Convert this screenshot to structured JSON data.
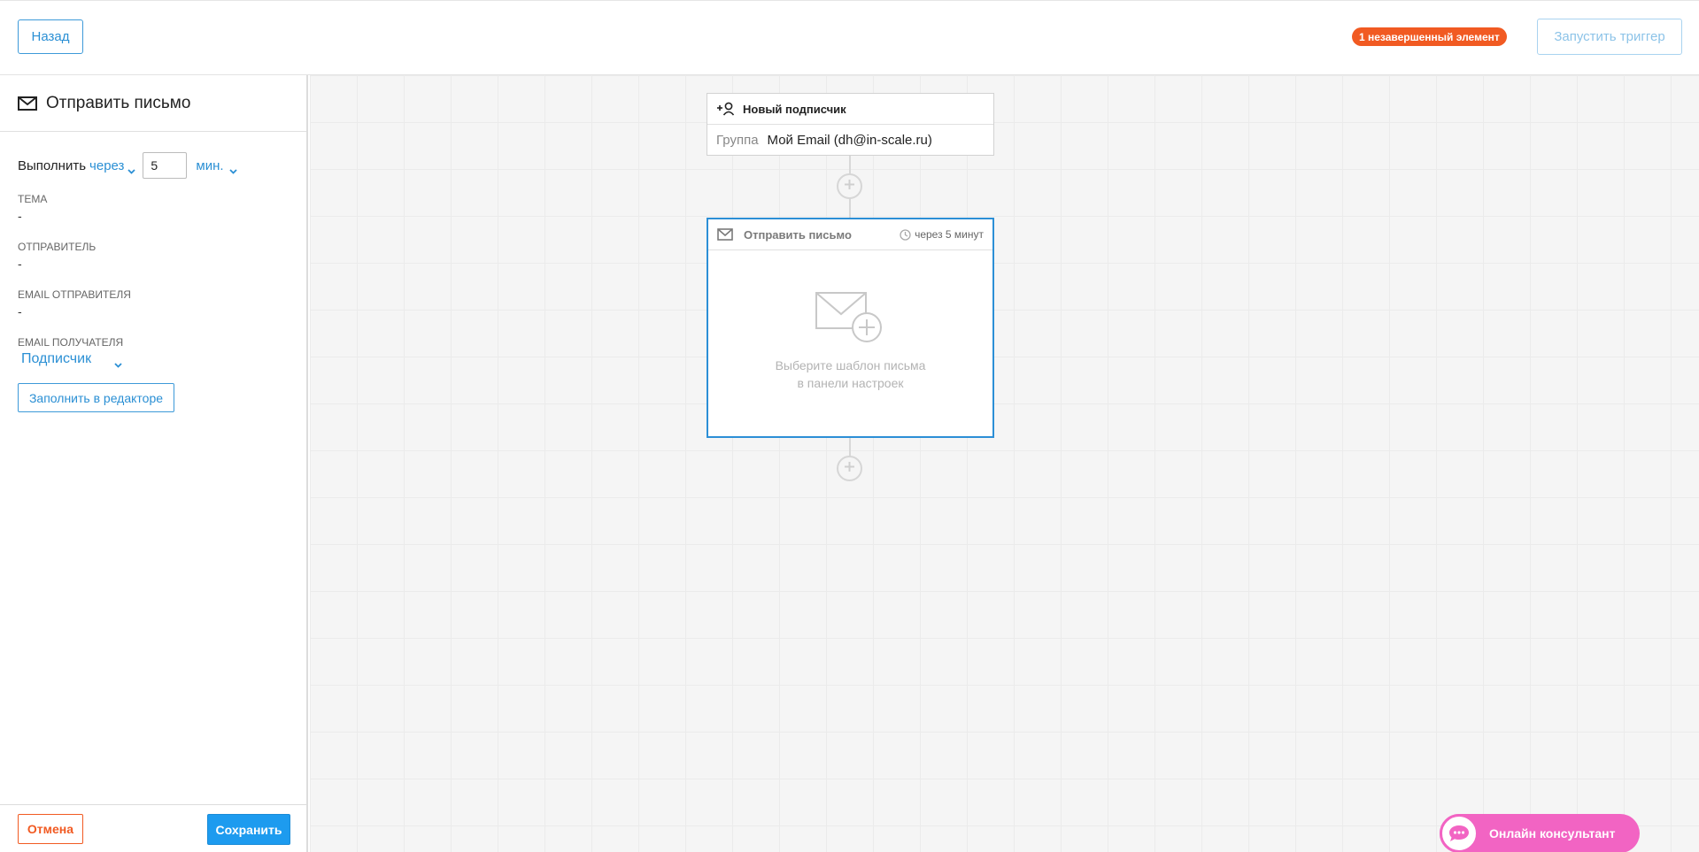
{
  "header": {
    "back_label": "Назад",
    "warning_badge": "1 незавершенный элемент",
    "run_label": "Запустить триггер",
    "badge_color": "#f15a22",
    "accent_color": "#2a8fd4"
  },
  "sidebar": {
    "title": "Отправить письмо",
    "title_icon": "envelope-icon",
    "exec": {
      "label": "Выполнить",
      "mode": "через",
      "value": "5",
      "unit": "мин."
    },
    "fields": [
      {
        "label": "Тема",
        "value": "-"
      },
      {
        "label": "Отправитель",
        "value": "-"
      },
      {
        "label": "Email отправителя",
        "value": "-"
      }
    ],
    "recipient": {
      "label": "Email получателя",
      "value": "Подписчик"
    },
    "fill_button": "Заполнить в редакторе",
    "cancel_label": "Отмена",
    "save_label": "Сохранить"
  },
  "canvas": {
    "trigger_node": {
      "title": "Новый подписчик",
      "icon": "add-user-icon",
      "group_label": "Группа",
      "group_value": "Мой Email (dh@in-scale.ru)"
    },
    "email_node": {
      "title": "Отправить письмо",
      "icon": "envelope-icon",
      "delay": "через 5 минут",
      "hint_line1": "Выберите шаблон письма",
      "hint_line2": "в панели настроек"
    }
  },
  "chat": {
    "label": "Онлайн консультант",
    "color": "#f264c3"
  }
}
